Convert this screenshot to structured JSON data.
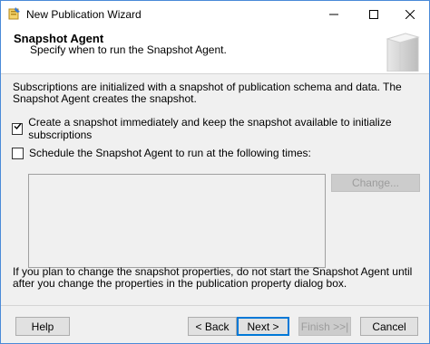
{
  "window": {
    "title": "New Publication Wizard",
    "controls": {
      "minimize": "—",
      "maximize": "☐",
      "close": "✕"
    }
  },
  "header": {
    "title": "Snapshot Agent",
    "subtitle": "Specify when to run the Snapshot Agent."
  },
  "content": {
    "intro": "Subscriptions are initialized with a snapshot of publication schema and data. The Snapshot Agent creates the snapshot.",
    "option_create_snapshot": {
      "label": "Create a snapshot immediately and keep the snapshot available to initialize subscriptions",
      "checked": true
    },
    "option_schedule": {
      "label": "Schedule the Snapshot Agent to run at the following times:",
      "checked": false
    },
    "change_button": "Change...",
    "note": "If you plan to change the snapshot properties, do not start the Snapshot Agent until after you change the properties in the publication property dialog box."
  },
  "footer": {
    "help": "Help",
    "back": "< Back",
    "next": "Next >",
    "finish": "Finish >>|",
    "cancel": "Cancel"
  }
}
